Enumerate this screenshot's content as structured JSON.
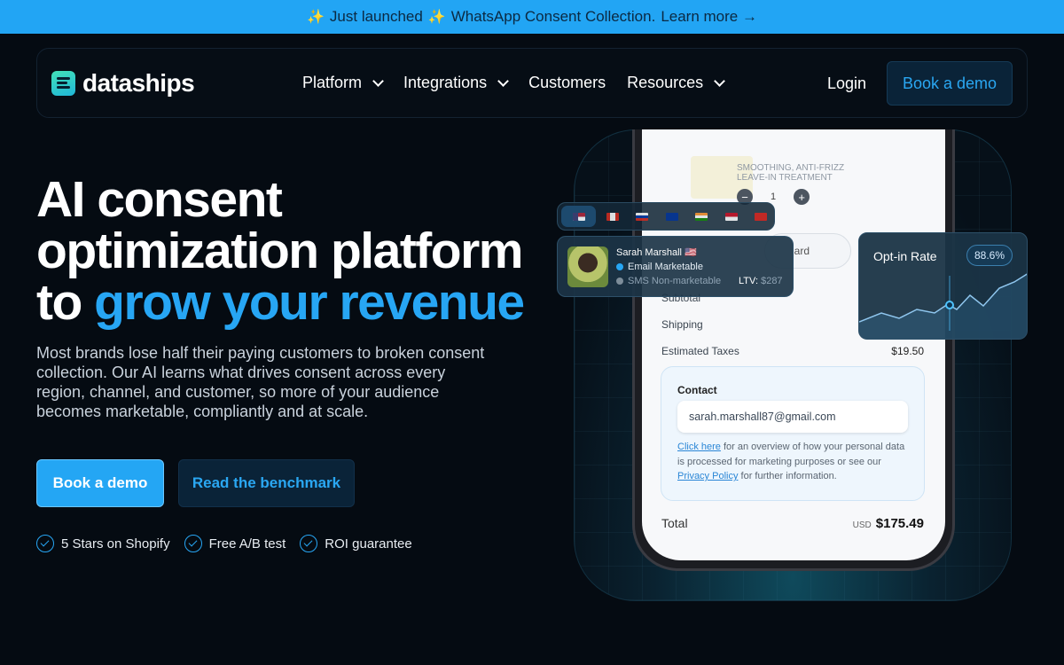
{
  "announcement": {
    "spark": "✨",
    "text": "Just launched",
    "spark2": "✨",
    "product": "WhatsApp Consent Collection.",
    "link": "Learn more →"
  },
  "nav": {
    "brand": "dataships",
    "links": [
      "Platform",
      "Integrations",
      "Customers",
      "Resources"
    ],
    "login": "Login",
    "cta": "Book a demo"
  },
  "hero": {
    "headline_1": "AI consent",
    "headline_2": "optimization platform",
    "headline_3": "to ",
    "headline_accent": "grow your revenue",
    "subtext": "Most brands lose half their paying customers to broken consent collection. Our AI learns what drives consent across every region, channel, and customer, so more of your audience becomes marketable, compliantly and at scale.",
    "primary_cta": "Book a demo",
    "secondary_cta": "Read the benchmark",
    "perks": [
      "5 Stars on Shopify",
      "Free A/B test",
      "ROI guarantee"
    ]
  },
  "checkout": {
    "product_desc": "SMOOTHING, ANTI-FRIZZ LEAVE-IN TREATMENT",
    "quantity": "1",
    "behind_pill": "ard",
    "subtotal_label": "Subtotal",
    "shipping_label": "Shipping",
    "taxes_label": "Estimated Taxes",
    "taxes_value": "$19.50",
    "contact_title": "Contact",
    "email": "sarah.marshall87@gmail.com",
    "fine_link1": "Click here",
    "fine_text1": " for an overview of how your personal data is processed for marketing purposes or see our ",
    "fine_link2": "Privacy Policy",
    "fine_text2": " for further information.",
    "total_label": "Total",
    "total_currency": "USD",
    "total_value": "$175.49"
  },
  "profile": {
    "name": "Sarah Marshall 🇺🇸",
    "email_status": "Email Marketable",
    "sms_status": "SMS Non-marketable",
    "ltv_label": "LTV:",
    "ltv_value": "$287"
  },
  "optin": {
    "label": "Opt-in Rate",
    "value": "88.6%"
  },
  "colors": {
    "accent": "#27a6f4",
    "background": "#050b12",
    "announcement": "#22a5f4"
  }
}
